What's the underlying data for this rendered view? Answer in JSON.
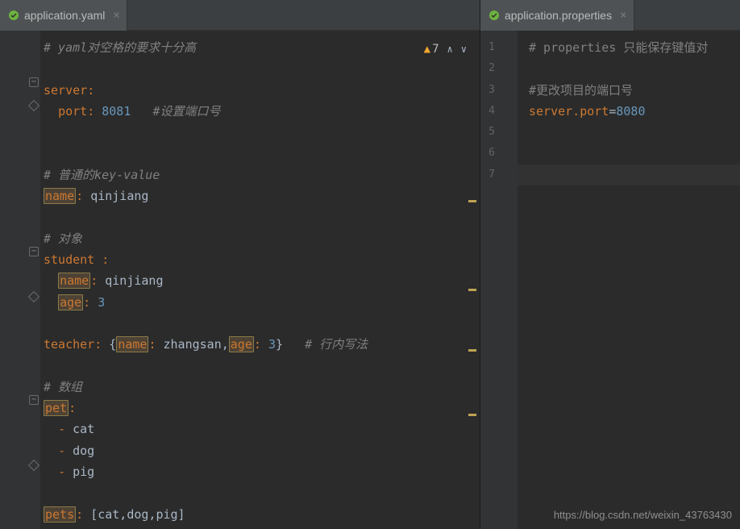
{
  "tabs": {
    "left": {
      "name": "application.yaml",
      "closeable": true
    },
    "right": {
      "name": "application.properties",
      "closeable": true
    }
  },
  "inspection": {
    "warnings": "7"
  },
  "left_code": {
    "l1_comment": "# yaml对空格的要求十分高",
    "l4_server": "server",
    "l5_port_key": "port",
    "l5_port_val": "8081",
    "l5_comment": "#设置端口号",
    "l8_comment": "# 普通的key-value",
    "l9_name_key": "name",
    "l9_name_val": "qinjiang",
    "l11_comment": "# 对象",
    "l12_student": "student",
    "l13_name_key": "name",
    "l13_name_val": "qinjiang",
    "l14_age_key": "age",
    "l14_age_val": "3",
    "l16_teacher": "teacher",
    "l16_name_key": "name",
    "l16_name_val": "zhangsan",
    "l16_age_key": "age",
    "l16_age_val": "3",
    "l16_comment": "# 行内写法",
    "l18_comment": "# 数组",
    "l19_pet": "pet",
    "l20_cat": "cat",
    "l21_dog": "dog",
    "l22_pig": "pig",
    "l24_pets": "pets",
    "l24_val": "[cat,dog,pig]"
  },
  "right_code": {
    "lines": [
      "1",
      "2",
      "3",
      "4",
      "5",
      "6",
      "7"
    ],
    "l1_comment_a": "# properties",
    "l1_comment_b": " 只能保存键值对",
    "l3_comment": "#更改项目的端口号",
    "l4_key": "server.port",
    "l4_val": "8080"
  },
  "watermark": "https://blog.csdn.net/weixin_43763430"
}
